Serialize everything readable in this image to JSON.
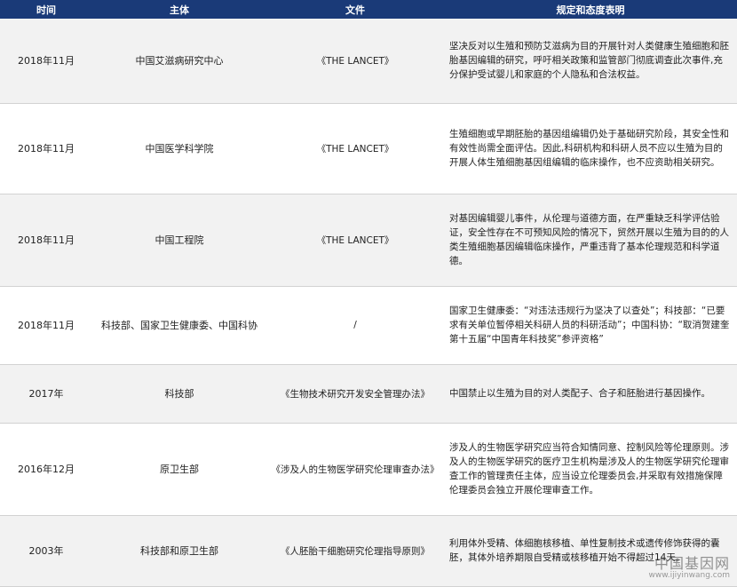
{
  "header": {
    "col_time": "时间",
    "col_subject": "主体",
    "col_document": "文件",
    "col_stance": "规定和态度表明"
  },
  "rows": [
    {
      "time": "2018年11月",
      "subject": "中国艾滋病研究中心",
      "document": "《THE LANCET》",
      "stance": "坚决反对以生殖和预防艾滋病为目的开展针对人类健康生殖细胞和胚胎基因编辑的研究，呼吁相关政策和监管部门彻底调查此次事件,充分保护受试婴儿和家庭的个人隐私和合法权益。"
    },
    {
      "time": "2018年11月",
      "subject": "中国医学科学院",
      "document": "《THE LANCET》",
      "stance": "生殖细胞或早期胚胎的基因组编辑仍处于基础研究阶段，其安全性和有效性尚需全面评估。因此,科研机构和科研人员不应以生殖为目的开展人体生殖细胞基因组编辑的临床操作，也不应资助相关研究。"
    },
    {
      "time": "2018年11月",
      "subject": "中国工程院",
      "document": "《THE LANCET》",
      "stance": "对基因编辑婴儿事件，从伦理与道德方面，在严重缺乏科学评估验证，安全性存在不可预知风险的情况下，贸然开展以生殖为目的的人类生殖细胞基因编辑临床操作，严重违背了基本伦理规范和科学道德。"
    },
    {
      "time": "2018年11月",
      "subject": "科技部、国家卫生健康委、中国科协",
      "document": "/",
      "stance": "国家卫生健康委：“对违法违规行为坚决了以查处”；科技部：“已要求有关单位暂停相关科研人员的科研活动”；中国科协：“取消贺建奎第十五届“中国青年科技奖”参评资格”"
    },
    {
      "time": "2017年",
      "subject": "科技部",
      "document": "《生物技术研究开发安全管理办法》",
      "stance": "中国禁止以生殖为目的对人类配子、合子和胚胎进行基因操作。"
    },
    {
      "time": "2016年12月",
      "subject": "原卫生部",
      "document": "《涉及人的生物医学研究伦理审查办法》",
      "stance": "涉及人的生物医学研究应当符合知情同意、控制风险等伦理原则。涉及人的生物医学研究的医疗卫生机构是涉及人的生物医学研究伦理审查工作的管理责任主体，应当设立伦理委员会,并采取有效措施保障伦理委员会独立开展伦理审查工作。"
    },
    {
      "time": "2003年",
      "subject": "科技部和原卫生部",
      "document": "《人胚胎干细胞研究伦理指导原则》",
      "stance": "利用体外受精、体细胞核移植、单性复制技术或遗传修饰获得的囊胚，其体外培养期限自受精或核移植开始不得超过14天。"
    }
  ],
  "watermark": {
    "name": "中国基因网",
    "url": "www.ijiyinwang.com"
  }
}
